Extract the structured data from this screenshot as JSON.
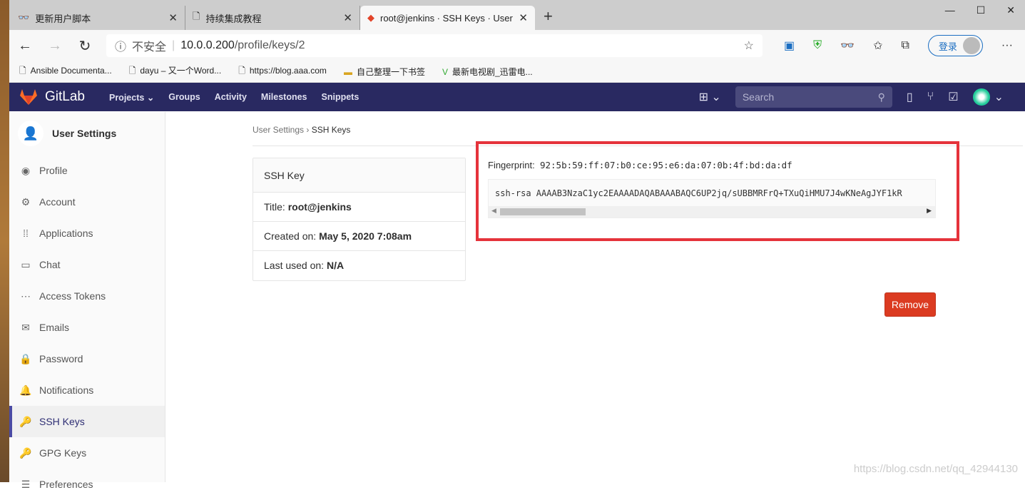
{
  "browser": {
    "tabs": [
      {
        "title": "更新用户脚本",
        "icon": "tampermonkey-icon"
      },
      {
        "title": "持续集成教程",
        "icon": "page-icon"
      },
      {
        "title": "root@jenkins · SSH Keys · User S",
        "icon": "gitlab-icon",
        "active": true
      }
    ],
    "security": "不安全",
    "url_host": "10.0.0.200",
    "url_path": "/profile/keys/2",
    "login": "登录",
    "bookmarks": [
      {
        "label": "Ansible Documenta...",
        "icon": "page-icon"
      },
      {
        "label": "dayu – 又一个Word...",
        "icon": "page-icon"
      },
      {
        "label": "https://blog.aaa.com",
        "icon": "page-icon"
      },
      {
        "label": "自己整理一下书签",
        "icon": "folder-icon"
      },
      {
        "label": "最新电视剧_迅雷电...",
        "icon": "site-icon"
      }
    ]
  },
  "gitlab": {
    "brand": "GitLab",
    "menu": [
      "Projects",
      "Groups",
      "Activity",
      "Milestones",
      "Snippets"
    ],
    "search_placeholder": "Search",
    "colors": {
      "navbar": "#292961",
      "accent": "#4b4ba3",
      "danger": "#db3b21",
      "highlight": "#e5333b"
    }
  },
  "sidebar": {
    "title": "User Settings",
    "items": [
      {
        "label": "Profile",
        "icon": "profile-icon"
      },
      {
        "label": "Account",
        "icon": "account-icon"
      },
      {
        "label": "Applications",
        "icon": "applications-icon"
      },
      {
        "label": "Chat",
        "icon": "chat-icon"
      },
      {
        "label": "Access Tokens",
        "icon": "token-icon"
      },
      {
        "label": "Emails",
        "icon": "email-icon"
      },
      {
        "label": "Password",
        "icon": "lock-icon"
      },
      {
        "label": "Notifications",
        "icon": "bell-icon"
      },
      {
        "label": "SSH Keys",
        "icon": "key-icon",
        "active": true
      },
      {
        "label": "GPG Keys",
        "icon": "key-icon"
      },
      {
        "label": "Preferences",
        "icon": "preferences-icon"
      }
    ]
  },
  "breadcrumb": {
    "parent": "User Settings",
    "current": "SSH Keys"
  },
  "key": {
    "card_title": "SSH Key",
    "title_label": "Title:",
    "title": "root@jenkins",
    "created_label": "Created on:",
    "created": "May 5, 2020 7:08am",
    "used_label": "Last used on:",
    "used": "N/A",
    "fingerprint_label": "Fingerprint:",
    "fingerprint": "92:5b:59:ff:07:b0:ce:95:e6:da:07:0b:4f:bd:da:df",
    "public_key": "ssh-rsa AAAAB3NzaC1yc2EAAAADAQABAAABAQC6UP2jq/sUBBMRFrQ+TXuQiHMU7J4wKNeAgJYF1kR",
    "remove": "Remove"
  },
  "watermark": "https://blog.csdn.net/qq_42944130"
}
